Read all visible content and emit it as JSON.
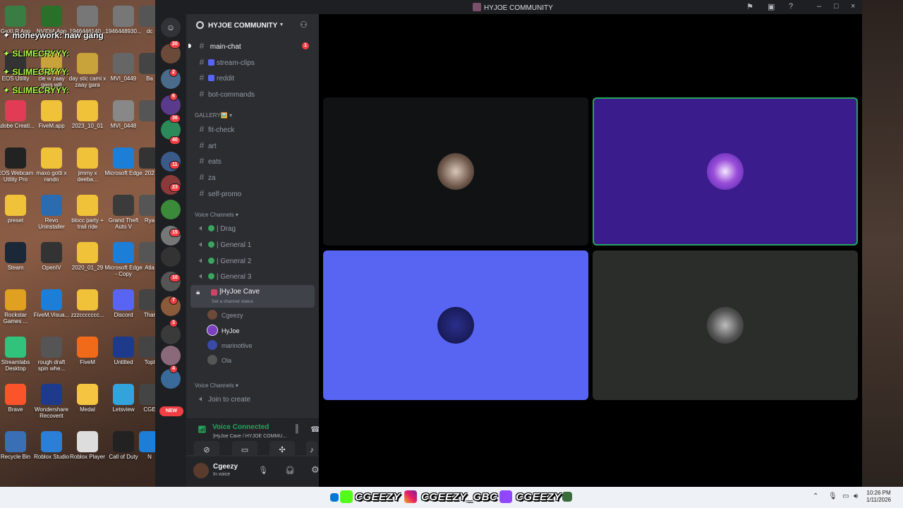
{
  "window": {
    "title": "HYJOE COMMUNITY"
  },
  "overlay": {
    "line1": "✦ moneywork:  naw gang",
    "line2": "✦ SLIMECRYYY:",
    "line3": "✦ SLIMECRYYY:",
    "line4": "✦ SLIMECRYYY:"
  },
  "desktop_icons": [
    "GeXLR App",
    "NVIDIA App",
    "1946446140...",
    "1946448930...",
    "dc",
    "EOS Utility",
    "cle w zaay gara will",
    "day stic cami x zaay gara",
    "MVI_0449",
    "Ba",
    "Adobe Creati...",
    "FiveM.app",
    "2023_10_01",
    "MVI_0448",
    "",
    "EOS Webcam Utility Pro",
    "maxo gotti x rando",
    "jimmy x deeba...",
    "Microsoft Edge",
    "202",
    "preset",
    "Revo Uninstaller",
    "blocc party + trail ride",
    "Grand Theft Auto V",
    "Rya",
    "Steam",
    "OpenIV",
    "2020_01_29",
    "Microsoft Edge - Copy",
    "Atla",
    "Rockstar Games ...",
    "FiveM.Visua...",
    "zzzccccccc...",
    "Discord",
    "Thar",
    "Streamlabs Desktop",
    "rough draft spin whe...",
    "FiveM",
    "Untitled",
    "Topl",
    "Brave",
    "Wondershare Recoverit",
    "Medal",
    "Letsview",
    "CGE",
    "Recycle Bin",
    "Roblox Studio",
    "Roblox Player",
    "Call of Duty",
    "N"
  ],
  "guild": {
    "name": "HYJOE COMMUNITY",
    "text_channels": [
      {
        "name": "main-chat",
        "mention": "1"
      },
      {
        "name": "stream-clips"
      },
      {
        "name": "reddit"
      },
      {
        "name": "bot-commands"
      }
    ],
    "gallery_label": "GALLERY🖼️",
    "gallery_channels": [
      "fit-check",
      "art",
      "eats",
      "za",
      "self-promo"
    ],
    "voice_label": "Voice Channels",
    "voice_channels": [
      "| Drag",
      "| General 1",
      "| General 2",
      "| General 3"
    ],
    "active_voice": {
      "name": "|HyJoe Cave",
      "status": "Set a channel status"
    },
    "members": [
      "Cgeezy",
      "HyJoe",
      "marinotlive",
      "Ola"
    ],
    "voice_label_2": "Voice Channels",
    "join_create": "Join to create"
  },
  "server_badges": [
    "20",
    "2",
    "6",
    "36",
    "40",
    "11",
    "23",
    "15",
    "10",
    "7",
    "3",
    "4"
  ],
  "new_label": "NEW",
  "voice_panel": {
    "title": "Voice Connected",
    "subtitle": "|HyJoe Cave / HYJOE COMMU..."
  },
  "user_panel": {
    "name": "Cgeezy",
    "status": "In voice"
  },
  "taskbar": {
    "tag1": "CGEEZY",
    "tag2": "CGEEZY_GBC",
    "tag3": "CGEEZY",
    "time": "10:26 PM",
    "date": "1/11/2026"
  },
  "colors": {
    "tile_dark": "#111214",
    "tile_purple": "#3b1c8c",
    "tile_blurple": "#5865f2",
    "tile_gray": "#2b2d2b",
    "speaking": "#23a55a"
  }
}
